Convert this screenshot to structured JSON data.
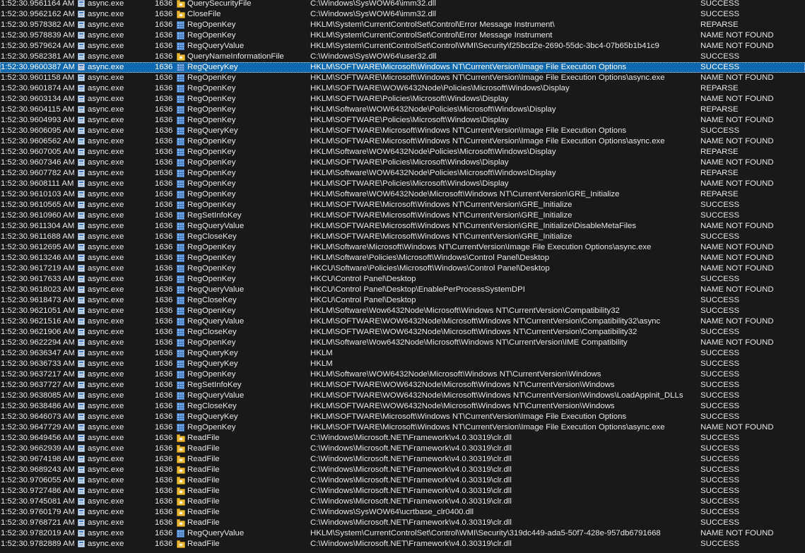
{
  "rows": [
    {
      "time": "1:52:30.9561164 AM",
      "process": "async.exe",
      "pid": "1636",
      "op_icon": "file-icon",
      "operation": "QuerySecurityFile",
      "path": "C:\\Windows\\SysWOW64\\imm32.dll",
      "result": "SUCCESS"
    },
    {
      "time": "1:52:30.9562162 AM",
      "process": "async.exe",
      "pid": "1636",
      "op_icon": "file-icon",
      "operation": "CloseFile",
      "path": "C:\\Windows\\SysWOW64\\imm32.dll",
      "result": "SUCCESS"
    },
    {
      "time": "1:52:30.9578382 AM",
      "process": "async.exe",
      "pid": "1636",
      "op_icon": "registry-icon",
      "operation": "RegOpenKey",
      "path": "HKLM\\System\\CurrentControlSet\\Control\\Error Message Instrument\\",
      "result": "REPARSE"
    },
    {
      "time": "1:52:30.9578839 AM",
      "process": "async.exe",
      "pid": "1636",
      "op_icon": "registry-icon",
      "operation": "RegOpenKey",
      "path": "HKLM\\System\\CurrentControlSet\\Control\\Error Message Instrument",
      "result": "NAME NOT FOUND"
    },
    {
      "time": "1:52:30.9579624 AM",
      "process": "async.exe",
      "pid": "1636",
      "op_icon": "registry-icon",
      "operation": "RegQueryValue",
      "path": "HKLM\\System\\CurrentControlSet\\Control\\WMI\\Security\\f25bcd2e-2690-55dc-3bc4-07b65b1b41c9",
      "result": "NAME NOT FOUND"
    },
    {
      "time": "1:52:30.9582381 AM",
      "process": "async.exe",
      "pid": "1636",
      "op_icon": "file-icon",
      "operation": "QueryNameInformationFile",
      "path": "C:\\Windows\\SysWOW64\\user32.dll",
      "result": "SUCCESS"
    },
    {
      "time": "1:52:30.9600387 AM",
      "process": "async.exe",
      "pid": "1636",
      "op_icon": "registry-icon",
      "operation": "RegQueryKey",
      "path": "HKLM\\SOFTWARE\\Microsoft\\Windows NT\\CurrentVersion\\Image File Execution Options",
      "result": "SUCCESS"
    },
    {
      "time": "1:52:30.9601158 AM",
      "process": "async.exe",
      "pid": "1636",
      "op_icon": "registry-icon",
      "operation": "RegOpenKey",
      "path": "HKLM\\SOFTWARE\\Microsoft\\Windows NT\\CurrentVersion\\Image File Execution Options\\async.exe",
      "result": "NAME NOT FOUND"
    },
    {
      "time": "1:52:30.9601874 AM",
      "process": "async.exe",
      "pid": "1636",
      "op_icon": "registry-icon",
      "operation": "RegOpenKey",
      "path": "HKLM\\SOFTWARE\\WOW6432Node\\Policies\\Microsoft\\Windows\\Display",
      "result": "REPARSE"
    },
    {
      "time": "1:52:30.9603134 AM",
      "process": "async.exe",
      "pid": "1636",
      "op_icon": "registry-icon",
      "operation": "RegOpenKey",
      "path": "HKLM\\SOFTWARE\\Policies\\Microsoft\\Windows\\Display",
      "result": "NAME NOT FOUND"
    },
    {
      "time": "1:52:30.9604115 AM",
      "process": "async.exe",
      "pid": "1636",
      "op_icon": "registry-icon",
      "operation": "RegOpenKey",
      "path": "HKLM\\Software\\WOW6432Node\\Policies\\Microsoft\\Windows\\Display",
      "result": "REPARSE"
    },
    {
      "time": "1:52:30.9604993 AM",
      "process": "async.exe",
      "pid": "1636",
      "op_icon": "registry-icon",
      "operation": "RegOpenKey",
      "path": "HKLM\\SOFTWARE\\Policies\\Microsoft\\Windows\\Display",
      "result": "NAME NOT FOUND"
    },
    {
      "time": "1:52:30.9606095 AM",
      "process": "async.exe",
      "pid": "1636",
      "op_icon": "registry-icon",
      "operation": "RegQueryKey",
      "path": "HKLM\\SOFTWARE\\Microsoft\\Windows NT\\CurrentVersion\\Image File Execution Options",
      "result": "SUCCESS"
    },
    {
      "time": "1:52:30.9606562 AM",
      "process": "async.exe",
      "pid": "1636",
      "op_icon": "registry-icon",
      "operation": "RegOpenKey",
      "path": "HKLM\\SOFTWARE\\Microsoft\\Windows NT\\CurrentVersion\\Image File Execution Options\\async.exe",
      "result": "NAME NOT FOUND"
    },
    {
      "time": "1:52:30.9607005 AM",
      "process": "async.exe",
      "pid": "1636",
      "op_icon": "registry-icon",
      "operation": "RegOpenKey",
      "path": "HKLM\\Software\\WOW6432Node\\Policies\\Microsoft\\Windows\\Display",
      "result": "REPARSE"
    },
    {
      "time": "1:52:30.9607346 AM",
      "process": "async.exe",
      "pid": "1636",
      "op_icon": "registry-icon",
      "operation": "RegOpenKey",
      "path": "HKLM\\SOFTWARE\\Policies\\Microsoft\\Windows\\Display",
      "result": "NAME NOT FOUND"
    },
    {
      "time": "1:52:30.9607782 AM",
      "process": "async.exe",
      "pid": "1636",
      "op_icon": "registry-icon",
      "operation": "RegOpenKey",
      "path": "HKLM\\Software\\WOW6432Node\\Policies\\Microsoft\\Windows\\Display",
      "result": "REPARSE"
    },
    {
      "time": "1:52:30.9608111 AM",
      "process": "async.exe",
      "pid": "1636",
      "op_icon": "registry-icon",
      "operation": "RegOpenKey",
      "path": "HKLM\\SOFTWARE\\Policies\\Microsoft\\Windows\\Display",
      "result": "NAME NOT FOUND"
    },
    {
      "time": "1:52:30.9610103 AM",
      "process": "async.exe",
      "pid": "1636",
      "op_icon": "registry-icon",
      "operation": "RegOpenKey",
      "path": "HKLM\\Software\\WOW6432Node\\Microsoft\\Windows NT\\CurrentVersion\\GRE_Initialize",
      "result": "REPARSE"
    },
    {
      "time": "1:52:30.9610565 AM",
      "process": "async.exe",
      "pid": "1636",
      "op_icon": "registry-icon",
      "operation": "RegOpenKey",
      "path": "HKLM\\SOFTWARE\\Microsoft\\Windows NT\\CurrentVersion\\GRE_Initialize",
      "result": "SUCCESS"
    },
    {
      "time": "1:52:30.9610960 AM",
      "process": "async.exe",
      "pid": "1636",
      "op_icon": "registry-icon",
      "operation": "RegSetInfoKey",
      "path": "HKLM\\SOFTWARE\\Microsoft\\Windows NT\\CurrentVersion\\GRE_Initialize",
      "result": "SUCCESS"
    },
    {
      "time": "1:52:30.9611304 AM",
      "process": "async.exe",
      "pid": "1636",
      "op_icon": "registry-icon",
      "operation": "RegQueryValue",
      "path": "HKLM\\SOFTWARE\\Microsoft\\Windows NT\\CurrentVersion\\GRE_Initialize\\DisableMetaFiles",
      "result": "NAME NOT FOUND"
    },
    {
      "time": "1:52:30.9611688 AM",
      "process": "async.exe",
      "pid": "1636",
      "op_icon": "registry-icon",
      "operation": "RegCloseKey",
      "path": "HKLM\\SOFTWARE\\Microsoft\\Windows NT\\CurrentVersion\\GRE_Initialize",
      "result": "SUCCESS"
    },
    {
      "time": "1:52:30.9612695 AM",
      "process": "async.exe",
      "pid": "1636",
      "op_icon": "registry-icon",
      "operation": "RegOpenKey",
      "path": "HKLM\\Software\\Microsoft\\Windows NT\\CurrentVersion\\Image File Execution Options\\async.exe",
      "result": "NAME NOT FOUND"
    },
    {
      "time": "1:52:30.9613246 AM",
      "process": "async.exe",
      "pid": "1636",
      "op_icon": "registry-icon",
      "operation": "RegOpenKey",
      "path": "HKLM\\Software\\Policies\\Microsoft\\Windows\\Control Panel\\Desktop",
      "result": "NAME NOT FOUND"
    },
    {
      "time": "1:52:30.9617219 AM",
      "process": "async.exe",
      "pid": "1636",
      "op_icon": "registry-icon",
      "operation": "RegOpenKey",
      "path": "HKCU\\Software\\Policies\\Microsoft\\Windows\\Control Panel\\Desktop",
      "result": "NAME NOT FOUND"
    },
    {
      "time": "1:52:30.9617633 AM",
      "process": "async.exe",
      "pid": "1636",
      "op_icon": "registry-icon",
      "operation": "RegOpenKey",
      "path": "HKCU\\Control Panel\\Desktop",
      "result": "SUCCESS"
    },
    {
      "time": "1:52:30.9618023 AM",
      "process": "async.exe",
      "pid": "1636",
      "op_icon": "registry-icon",
      "operation": "RegQueryValue",
      "path": "HKCU\\Control Panel\\Desktop\\EnablePerProcessSystemDPI",
      "result": "NAME NOT FOUND"
    },
    {
      "time": "1:52:30.9618473 AM",
      "process": "async.exe",
      "pid": "1636",
      "op_icon": "registry-icon",
      "operation": "RegCloseKey",
      "path": "HKCU\\Control Panel\\Desktop",
      "result": "SUCCESS"
    },
    {
      "time": "1:52:30.9621051 AM",
      "process": "async.exe",
      "pid": "1636",
      "op_icon": "registry-icon",
      "operation": "RegOpenKey",
      "path": "HKLM\\Software\\Wow6432Node\\Microsoft\\Windows NT\\CurrentVersion\\Compatibility32",
      "result": "SUCCESS"
    },
    {
      "time": "1:52:30.9621516 AM",
      "process": "async.exe",
      "pid": "1636",
      "op_icon": "registry-icon",
      "operation": "RegQueryValue",
      "path": "HKLM\\SOFTWARE\\WOW6432Node\\Microsoft\\Windows NT\\CurrentVersion\\Compatibility32\\async",
      "result": "NAME NOT FOUND"
    },
    {
      "time": "1:52:30.9621906 AM",
      "process": "async.exe",
      "pid": "1636",
      "op_icon": "registry-icon",
      "operation": "RegCloseKey",
      "path": "HKLM\\SOFTWARE\\WOW6432Node\\Microsoft\\Windows NT\\CurrentVersion\\Compatibility32",
      "result": "SUCCESS"
    },
    {
      "time": "1:52:30.9622294 AM",
      "process": "async.exe",
      "pid": "1636",
      "op_icon": "registry-icon",
      "operation": "RegOpenKey",
      "path": "HKLM\\Software\\Wow6432Node\\Microsoft\\Windows NT\\CurrentVersion\\IME Compatibility",
      "result": "NAME NOT FOUND"
    },
    {
      "time": "1:52:30.9636347 AM",
      "process": "async.exe",
      "pid": "1636",
      "op_icon": "registry-icon",
      "operation": "RegQueryKey",
      "path": "HKLM",
      "result": "SUCCESS"
    },
    {
      "time": "1:52:30.9636733 AM",
      "process": "async.exe",
      "pid": "1636",
      "op_icon": "registry-icon",
      "operation": "RegQueryKey",
      "path": "HKLM",
      "result": "SUCCESS"
    },
    {
      "time": "1:52:30.9637217 AM",
      "process": "async.exe",
      "pid": "1636",
      "op_icon": "registry-icon",
      "operation": "RegOpenKey",
      "path": "HKLM\\Software\\WOW6432Node\\Microsoft\\Windows NT\\CurrentVersion\\Windows",
      "result": "SUCCESS"
    },
    {
      "time": "1:52:30.9637727 AM",
      "process": "async.exe",
      "pid": "1636",
      "op_icon": "registry-icon",
      "operation": "RegSetInfoKey",
      "path": "HKLM\\SOFTWARE\\WOW6432Node\\Microsoft\\Windows NT\\CurrentVersion\\Windows",
      "result": "SUCCESS"
    },
    {
      "time": "1:52:30.9638085 AM",
      "process": "async.exe",
      "pid": "1636",
      "op_icon": "registry-icon",
      "operation": "RegQueryValue",
      "path": "HKLM\\SOFTWARE\\WOW6432Node\\Microsoft\\Windows NT\\CurrentVersion\\Windows\\LoadAppInit_DLLs",
      "result": "SUCCESS"
    },
    {
      "time": "1:52:30.9638486 AM",
      "process": "async.exe",
      "pid": "1636",
      "op_icon": "registry-icon",
      "operation": "RegCloseKey",
      "path": "HKLM\\SOFTWARE\\WOW6432Node\\Microsoft\\Windows NT\\CurrentVersion\\Windows",
      "result": "SUCCESS"
    },
    {
      "time": "1:52:30.9646073 AM",
      "process": "async.exe",
      "pid": "1636",
      "op_icon": "registry-icon",
      "operation": "RegQueryKey",
      "path": "HKLM\\SOFTWARE\\Microsoft\\Windows NT\\CurrentVersion\\Image File Execution Options",
      "result": "SUCCESS"
    },
    {
      "time": "1:52:30.9647729 AM",
      "process": "async.exe",
      "pid": "1636",
      "op_icon": "registry-icon",
      "operation": "RegOpenKey",
      "path": "HKLM\\SOFTWARE\\Microsoft\\Windows NT\\CurrentVersion\\Image File Execution Options\\async.exe",
      "result": "NAME NOT FOUND"
    },
    {
      "time": "1:52:30.9649456 AM",
      "process": "async.exe",
      "pid": "1636",
      "op_icon": "file-icon",
      "operation": "ReadFile",
      "path": "C:\\Windows\\Microsoft.NET\\Framework\\v4.0.30319\\clr.dll",
      "result": "SUCCESS"
    },
    {
      "time": "1:52:30.9662939 AM",
      "process": "async.exe",
      "pid": "1636",
      "op_icon": "file-icon",
      "operation": "ReadFile",
      "path": "C:\\Windows\\Microsoft.NET\\Framework\\v4.0.30319\\clr.dll",
      "result": "SUCCESS"
    },
    {
      "time": "1:52:30.9674198 AM",
      "process": "async.exe",
      "pid": "1636",
      "op_icon": "file-icon",
      "operation": "ReadFile",
      "path": "C:\\Windows\\Microsoft.NET\\Framework\\v4.0.30319\\clr.dll",
      "result": "SUCCESS"
    },
    {
      "time": "1:52:30.9689243 AM",
      "process": "async.exe",
      "pid": "1636",
      "op_icon": "file-icon",
      "operation": "ReadFile",
      "path": "C:\\Windows\\Microsoft.NET\\Framework\\v4.0.30319\\clr.dll",
      "result": "SUCCESS"
    },
    {
      "time": "1:52:30.9706055 AM",
      "process": "async.exe",
      "pid": "1636",
      "op_icon": "file-icon",
      "operation": "ReadFile",
      "path": "C:\\Windows\\Microsoft.NET\\Framework\\v4.0.30319\\clr.dll",
      "result": "SUCCESS"
    },
    {
      "time": "1:52:30.9727486 AM",
      "process": "async.exe",
      "pid": "1636",
      "op_icon": "file-icon",
      "operation": "ReadFile",
      "path": "C:\\Windows\\Microsoft.NET\\Framework\\v4.0.30319\\clr.dll",
      "result": "SUCCESS"
    },
    {
      "time": "1:52:30.9745081 AM",
      "process": "async.exe",
      "pid": "1636",
      "op_icon": "file-icon",
      "operation": "ReadFile",
      "path": "C:\\Windows\\Microsoft.NET\\Framework\\v4.0.30319\\clr.dll",
      "result": "SUCCESS"
    },
    {
      "time": "1:52:30.9760179 AM",
      "process": "async.exe",
      "pid": "1636",
      "op_icon": "file-icon",
      "operation": "ReadFile",
      "path": "C:\\Windows\\SysWOW64\\ucrtbase_clr0400.dll",
      "result": "SUCCESS"
    },
    {
      "time": "1:52:30.9768721 AM",
      "process": "async.exe",
      "pid": "1636",
      "op_icon": "file-icon",
      "operation": "ReadFile",
      "path": "C:\\Windows\\Microsoft.NET\\Framework\\v4.0.30319\\clr.dll",
      "result": "SUCCESS"
    },
    {
      "time": "1:52:30.9782019 AM",
      "process": "async.exe",
      "pid": "1636",
      "op_icon": "registry-icon",
      "operation": "RegQueryValue",
      "path": "HKLM\\System\\CurrentControlSet\\Control\\WMI\\Security\\319dc449-ada5-50f7-428e-957db6791668",
      "result": "NAME NOT FOUND"
    },
    {
      "time": "1:52:30.9782889 AM",
      "process": "async.exe",
      "pid": "1636",
      "op_icon": "file-icon",
      "operation": "ReadFile",
      "path": "C:\\Windows\\Microsoft.NET\\Framework\\v4.0.30319\\clr.dll",
      "result": "SUCCESS"
    }
  ],
  "selected_row": 6,
  "process_icon": "application-icon",
  "colors": {
    "background": "#191919",
    "text": "#e6e6e6",
    "selection": "#0e68b0"
  }
}
